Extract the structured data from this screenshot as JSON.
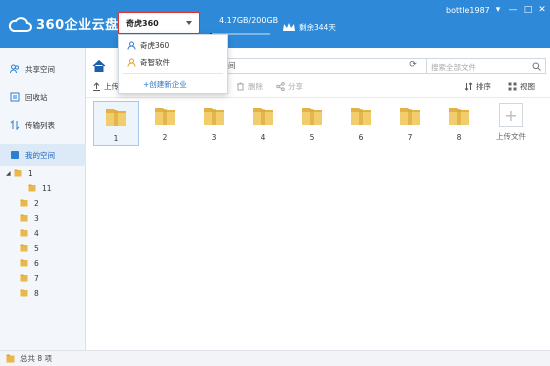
{
  "app": {
    "name": "360企业云盘",
    "username": "bottle1987"
  },
  "company_selector": {
    "current": "奇虎360"
  },
  "quota": {
    "text": "4.17GB/200GB",
    "used_fraction": 0.021
  },
  "vip": {
    "text": "剩余344天"
  },
  "window_controls": [
    "▾",
    "—",
    "□",
    "✕"
  ],
  "dropdown": {
    "items": [
      {
        "label": "奇虎360",
        "icon": "user-icon"
      },
      {
        "label": "奇智软件",
        "icon": "user-gold-icon"
      }
    ],
    "create_label": "+创建新企业"
  },
  "sidebar": {
    "items": [
      {
        "label": "共享空间",
        "icon": "shared-icon"
      },
      {
        "label": "回收站",
        "icon": "recycle-icon"
      },
      {
        "label": "传输列表",
        "icon": "transfer-icon"
      },
      {
        "label": "我的空间",
        "icon": "my-space-icon"
      }
    ],
    "tree": [
      {
        "label": "1",
        "expanded": true
      },
      {
        "label": "11"
      },
      {
        "label": "2"
      },
      {
        "label": "3"
      },
      {
        "label": "4"
      },
      {
        "label": "5"
      },
      {
        "label": "6"
      },
      {
        "label": "7"
      },
      {
        "label": "8"
      }
    ]
  },
  "address": {
    "path_tail": "间",
    "search_placeholder": "搜索全部文件"
  },
  "toolbar": {
    "upload": "上传",
    "delete": "删除",
    "share": "分享",
    "sort": "排序",
    "view": "视图"
  },
  "files": [
    "1",
    "2",
    "3",
    "4",
    "5",
    "6",
    "7",
    "8"
  ],
  "upload_file_label": "上传文件",
  "status": {
    "text": "总共 8 项"
  }
}
